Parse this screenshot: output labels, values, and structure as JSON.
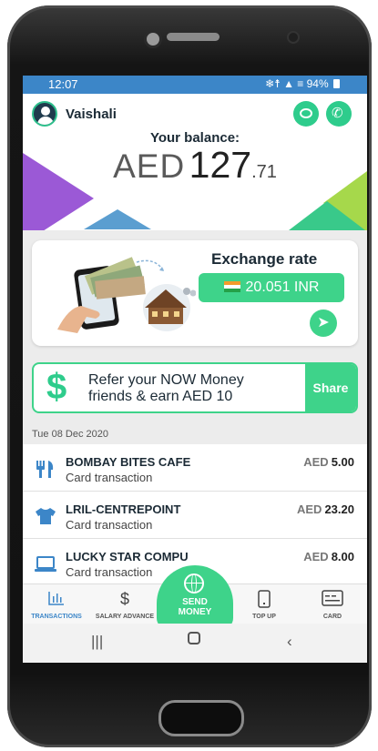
{
  "status_bar": {
    "time": "12:07",
    "icons": "❄☨ ▲ ≡",
    "battery": "94%"
  },
  "header": {
    "user_name": "Vaishali",
    "balance_label": "Your balance:",
    "balance_currency": "AED",
    "balance_whole": "127",
    "balance_decimal": ".71"
  },
  "exchange": {
    "title": "Exchange rate",
    "rate": "20.051 INR"
  },
  "refer": {
    "text_line1": "Refer your NOW Money",
    "text_line2": "friends & earn AED 10",
    "share_label": "Share"
  },
  "date_label": "Tue 08 Dec 2020",
  "transactions": [
    {
      "name": "BOMBAY BITES CAFE",
      "type": "Card transaction",
      "currency": "AED",
      "amount": "5.00",
      "icon": "restaurant-icon"
    },
    {
      "name": "LRIL-CENTREPOINT",
      "type": "Card transaction",
      "currency": "AED",
      "amount": "23.20",
      "icon": "tshirt-icon"
    },
    {
      "name": "LUCKY STAR COMPU",
      "type": "Card transaction",
      "currency": "AED",
      "amount": "8.00",
      "icon": "laptop-icon"
    }
  ],
  "tabs": [
    {
      "label": "TRANSACTIONS",
      "icon": "bar-chart-icon",
      "active": true
    },
    {
      "label": "SALARY ADVANCE",
      "icon": "dollar-icon",
      "active": false
    },
    {
      "label": "TOP UP",
      "icon": "mobile-icon",
      "active": false
    },
    {
      "label": "CARD",
      "icon": "card-icon",
      "active": false
    }
  ],
  "send_money": {
    "line1": "SEND",
    "line2": "MONEY"
  },
  "colors": {
    "accent_green": "#3ed38a",
    "status_blue": "#3c86c8",
    "text_dark": "#1b2a35"
  }
}
